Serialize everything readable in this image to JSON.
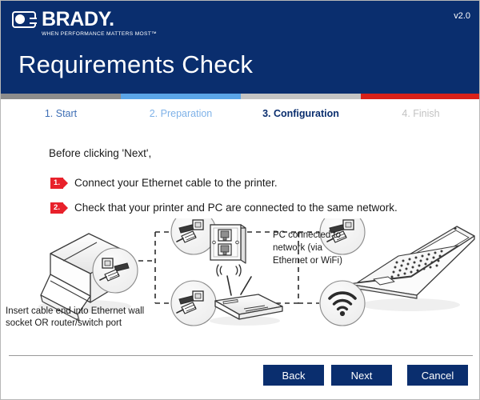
{
  "window": {
    "border_color": "#b7b7b7"
  },
  "header": {
    "brand_name": "BRADY.",
    "brand_tagline": "WHEN PERFORMANCE MATTERS MOST™",
    "logo_icon": "brady-logo-icon",
    "version": "v2.0",
    "title": "Requirements Check",
    "background": "#0a2e6e"
  },
  "steps": [
    {
      "label": "1. Start",
      "bar_color": "#8c8c8c",
      "text_color": "#3f6fb5",
      "width_pct": 25,
      "active": false
    },
    {
      "label": "2. Preparation",
      "bar_color": "#5aa5e8",
      "text_color": "#7fb2e8",
      "width_pct": 25,
      "active": false
    },
    {
      "label": "3. Configuration",
      "bar_color": "#c4c4c4",
      "text_color": "#0a2e6e",
      "width_pct": 25,
      "active": true
    },
    {
      "label": "4. Finish",
      "bar_color": "#d92118",
      "text_color": "#c2c2c2",
      "width_pct": 25,
      "active": false
    }
  ],
  "main": {
    "intro": "Before clicking 'Next',",
    "instructions": [
      {
        "number": "1.",
        "text": "Connect your Ethernet cable to the printer."
      },
      {
        "number": "2.",
        "text": "Check that your printer and PC are connected to the same network."
      }
    ],
    "diagram": {
      "caption_line1": "Insert cable end into Ethernet wall",
      "caption_line2": "socket OR router/switch port",
      "pc_note_line1": "PC connected to",
      "pc_note_line2": "network (via",
      "pc_note_line3": "Ethernet or WiFi)",
      "icons": {
        "printer": "printer-icon",
        "printer_port": "ethernet-plug-icon",
        "wall_socket": "ethernet-wall-socket-icon",
        "wall_socket_plug": "ethernet-plug-icon",
        "router": "router-icon",
        "router_plug": "ethernet-plug-icon",
        "laptop": "laptop-icon",
        "laptop_plug": "ethernet-plug-icon",
        "wifi": "wifi-icon"
      }
    }
  },
  "footer": {
    "buttons": [
      {
        "label": "Back",
        "name": "back-button"
      },
      {
        "label": "Next",
        "name": "next-button"
      },
      {
        "label": "Cancel",
        "name": "cancel-button"
      }
    ],
    "button_color": "#0a2e6e"
  }
}
